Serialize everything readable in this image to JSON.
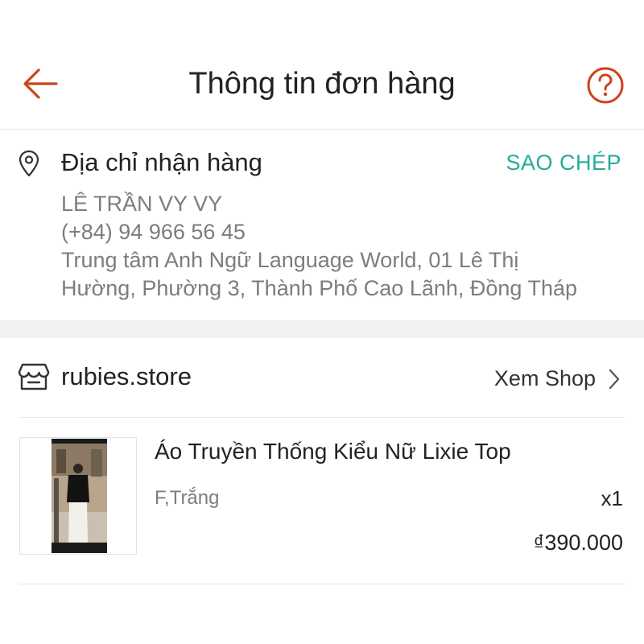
{
  "header": {
    "title": "Thông tin đơn hàng",
    "back_icon": "arrow-left-icon",
    "help_icon": "question-circle-icon",
    "accent_color": "#d0421b"
  },
  "address": {
    "icon": "location-pin-icon",
    "heading": "Địa chỉ nhận hàng",
    "copy_label": "SAO CHÉP",
    "copy_color": "#26aa99",
    "name": "LÊ TRẦN VY VY",
    "phone": "(+84) 94 966 56 45",
    "line1": "Trung tâm Anh Ngữ Language World, 01 Lê Thị",
    "line2": "Hường, Phường 3, Thành Phố Cao Lãnh, Đồng Tháp"
  },
  "shop": {
    "icon": "storefront-icon",
    "name": "rubies.store",
    "view_label": "Xem Shop",
    "chevron_icon": "chevron-right-icon"
  },
  "product": {
    "name": "Áo Truyền Thống Kiểu Nữ Lixie Top",
    "variant": "F,Trắng",
    "quantity": "x1",
    "price": "₫390.000"
  }
}
